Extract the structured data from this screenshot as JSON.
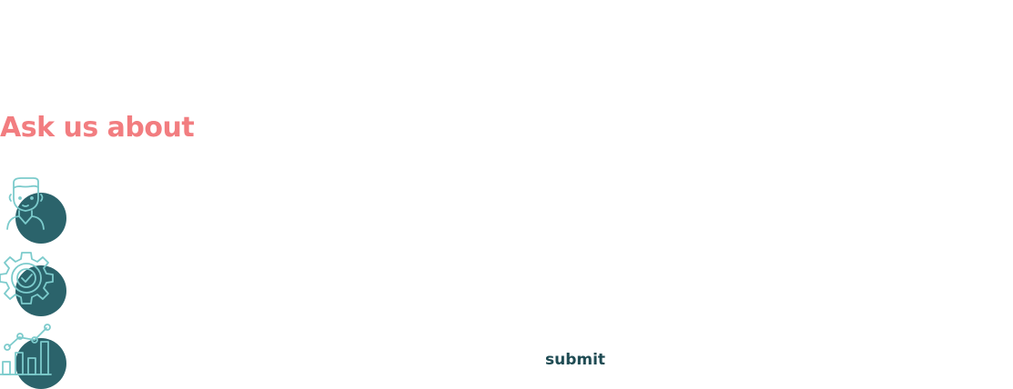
{
  "section": {
    "heading": "Ask us about"
  },
  "features": [
    {
      "icon": "person-icon"
    },
    {
      "icon": "gear-check-icon"
    },
    {
      "icon": "growth-chart-icon"
    }
  ],
  "form": {
    "submit_label": "submit"
  },
  "colors": {
    "heading": "#f27d80",
    "disc": "#2b636b",
    "icon_stroke": "#7ccbcc",
    "submit_text": "#1e4b53"
  }
}
